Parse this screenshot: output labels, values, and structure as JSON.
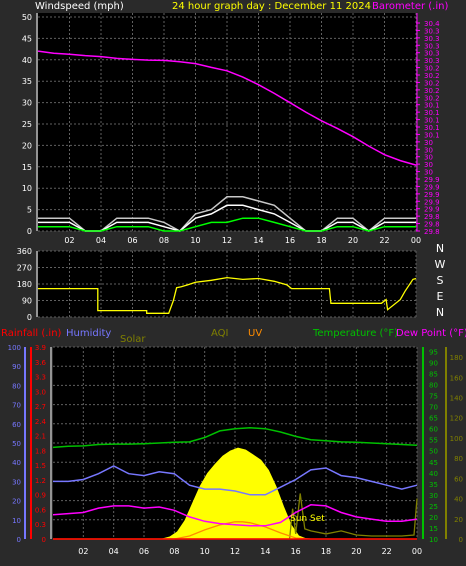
{
  "colors": {
    "background": "#2a2a2a",
    "plot_background": "#000000",
    "grid": "#606060",
    "white_text": "#ffffff",
    "wind": "#ffffff",
    "gust": "#c8c8c8",
    "wind_avg": "#00ff00",
    "barometer": "#ff00ff",
    "direction": "#ffff00",
    "rain": "#ff0000",
    "humidity": "#7777ff",
    "solar": "#ffff00",
    "aqi": "#808000",
    "uv": "#ff8c00",
    "temperature": "#00c000",
    "dewpoint": "#ff00ff",
    "title": "#ffff00"
  },
  "header": {
    "left_label": "Windspeed (mph)",
    "title": "24 hour graph day : December 11 2024",
    "right_label": "Barometer (.in)"
  },
  "legend": {
    "rain": "Rainfall (.in)",
    "humidity": "Humidity",
    "solar": "Solar",
    "aqi": "AQI",
    "uv": "UV",
    "temperature": "Temperature (°F)",
    "dewpoint": "Dew Point (°F)"
  },
  "annotations": {
    "sunset": "Sun Set"
  },
  "chart_data": [
    {
      "type": "line",
      "name": "wind-barometer",
      "x_ticks": [
        "02",
        "04",
        "06",
        "08",
        "10",
        "12",
        "14",
        "16",
        "18",
        "20",
        "22",
        "00"
      ],
      "y_left_ticks": [
        "0",
        "5",
        "10",
        "15",
        "20",
        "25",
        "30",
        "35",
        "40",
        "45",
        "50"
      ],
      "y_left_range": [
        0,
        50
      ],
      "y_right_ticks": [
        "29.8",
        "29.9",
        "30",
        "30.1",
        "30.2",
        "30.3",
        "30.4"
      ],
      "y_right_minor_ticks": [
        "29.8",
        "29.8",
        "29.8",
        "29.9",
        "29.9",
        "29.9",
        "29.9",
        "29.9",
        "30",
        "30",
        "30",
        "30",
        "30",
        "30.1",
        "30.1",
        "30.1",
        "30.1",
        "30.1",
        "30.2",
        "30.2",
        "30.2",
        "30.2",
        "30.2",
        "30.3",
        "30.3",
        "30.3",
        "30.3",
        "30.3",
        "30.4"
      ],
      "y_right_range": [
        29.8,
        30.4
      ],
      "x_range_hours": [
        0,
        24
      ],
      "series": [
        {
          "key": "barometer",
          "x": [
            0,
            1,
            2,
            3,
            4,
            5,
            6,
            7,
            8,
            9,
            10,
            11,
            12,
            13,
            14,
            15,
            16,
            17,
            18,
            19,
            20,
            21,
            22,
            23,
            24
          ],
          "values": [
            30.319,
            30.313,
            30.31,
            30.306,
            30.303,
            30.298,
            30.295,
            30.293,
            30.292,
            30.288,
            30.283,
            30.272,
            30.262,
            30.244,
            30.222,
            30.197,
            30.17,
            30.143,
            30.118,
            30.096,
            30.072,
            30.045,
            30.02,
            30.003,
            29.99
          ]
        },
        {
          "key": "gust",
          "x": [
            0,
            1,
            2,
            3,
            4,
            5,
            6,
            7,
            8,
            9,
            10,
            11,
            12,
            13,
            14,
            15,
            16,
            17,
            18,
            19,
            20,
            21,
            22,
            23,
            24
          ],
          "values": [
            3,
            3,
            3,
            0,
            0,
            3,
            3,
            3,
            2,
            0,
            4,
            5,
            8,
            8,
            7,
            6,
            3,
            0,
            0,
            3,
            3,
            0,
            3,
            3,
            3
          ]
        },
        {
          "key": "wind",
          "x": [
            0,
            1,
            2,
            3,
            4,
            5,
            6,
            7,
            8,
            9,
            10,
            11,
            12,
            13,
            14,
            15,
            16,
            17,
            18,
            19,
            20,
            21,
            22,
            23,
            24
          ],
          "values": [
            2,
            2,
            2,
            0,
            0,
            2,
            2,
            2,
            1,
            0,
            3,
            4,
            6,
            6,
            5,
            4,
            2,
            0,
            0,
            2,
            2,
            0,
            2,
            2,
            2
          ]
        },
        {
          "key": "wind_avg",
          "x": [
            0,
            1,
            2,
            3,
            4,
            5,
            6,
            7,
            8,
            9,
            10,
            11,
            12,
            13,
            14,
            15,
            16,
            17,
            18,
            19,
            20,
            21,
            22,
            23,
            24
          ],
          "values": [
            1,
            1,
            1,
            0,
            0,
            1,
            1,
            1,
            0,
            0,
            1,
            2,
            2,
            3,
            3,
            2,
            1,
            0,
            0,
            1,
            1,
            0,
            1,
            1,
            1
          ]
        }
      ]
    },
    {
      "type": "line",
      "name": "wind-direction",
      "y_left_ticks": [
        "0",
        "90",
        "180",
        "270",
        "360"
      ],
      "y_left_range": [
        0,
        360
      ],
      "compass": [
        "N",
        "W",
        "S",
        "E",
        "N"
      ],
      "x_range_hours": [
        0,
        24
      ],
      "series": [
        {
          "key": "direction",
          "x": [
            0,
            3.8,
            3.8,
            6.9,
            6.9,
            7.5,
            8.0,
            8.3,
            8.6,
            8.8,
            9.1,
            9.5,
            10,
            11,
            12,
            13,
            14,
            15,
            15.8,
            16.1,
            18.5,
            18.6,
            21.8,
            22.1,
            22.2,
            23,
            23.3,
            23.8,
            24
          ],
          "values": [
            155,
            155,
            35,
            35,
            20,
            20,
            20,
            20,
            90,
            160,
            165,
            175,
            190,
            200,
            215,
            205,
            210,
            195,
            175,
            155,
            155,
            75,
            75,
            95,
            40,
            95,
            140,
            205,
            210
          ]
        }
      ]
    },
    {
      "type": "area",
      "name": "temperature-humidity-rain-solar",
      "x_range_hours": [
        0,
        24
      ],
      "axes": {
        "humidity": {
          "ticks": [
            "0",
            "10",
            "20",
            "30",
            "40",
            "50",
            "60",
            "70",
            "80",
            "90",
            "100"
          ],
          "range": [
            0,
            100
          ]
        },
        "rain": {
          "ticks": [
            "0",
            "0.3",
            "0.6",
            "0.9",
            "1.2",
            "1.5",
            "1.8",
            "2.1",
            "2.4",
            "2.7",
            "3.0",
            "3.3",
            "3.6",
            "3.9"
          ],
          "range": [
            0,
            3.9
          ]
        },
        "temperature": {
          "ticks": [
            "10",
            "15",
            "20",
            "25",
            "30",
            "35",
            "40",
            "45",
            "50",
            "55",
            "60",
            "65",
            "70",
            "75",
            "80",
            "85",
            "90",
            "95"
          ],
          "range": [
            10,
            97
          ]
        },
        "solar": {
          "ticks": [
            "0",
            "20",
            "40",
            "60",
            "80",
            "100",
            "120",
            "140",
            "160",
            "180"
          ],
          "range": [
            0,
            190
          ]
        }
      },
      "series": [
        {
          "key": "temperature",
          "x": [
            0,
            1,
            2,
            3,
            4,
            5,
            6,
            7,
            8,
            9,
            10,
            11,
            12,
            13,
            14,
            15,
            16,
            17,
            18,
            19,
            20,
            21,
            22,
            23,
            24
          ],
          "values": [
            51.5,
            52,
            52.2,
            52.8,
            53,
            53,
            53.2,
            53.5,
            53.8,
            54,
            56,
            59,
            60,
            60.4,
            60,
            58.5,
            56.5,
            55,
            54.5,
            54,
            53.8,
            53.5,
            53.2,
            52.8,
            52.5
          ]
        },
        {
          "key": "humidity",
          "x": [
            0,
            1,
            2,
            3,
            4,
            5,
            6,
            7,
            8,
            9,
            10,
            11,
            12,
            13,
            14,
            15,
            16,
            17,
            18,
            19,
            20,
            21,
            22,
            23,
            24
          ],
          "values": [
            30,
            30,
            31,
            34,
            38,
            34,
            33,
            35,
            34,
            28,
            26,
            26,
            25,
            23,
            23,
            27,
            31,
            36,
            37,
            33,
            32,
            30,
            28,
            26,
            28
          ]
        },
        {
          "key": "dewpoint",
          "x": [
            0,
            1,
            2,
            3,
            4,
            5,
            6,
            7,
            8,
            9,
            10,
            11,
            12,
            13,
            14,
            15,
            16,
            17,
            18,
            19,
            20,
            21,
            22,
            23,
            24
          ],
          "values": [
            21,
            21.5,
            22,
            24,
            25,
            25,
            24,
            24.5,
            23,
            20,
            18,
            17,
            16.5,
            16,
            16,
            17.5,
            22,
            25.5,
            25,
            22,
            20,
            19,
            18,
            18,
            19
          ]
        },
        {
          "key": "solar",
          "x": [
            0,
            7.2,
            7.7,
            8.2,
            8.7,
            9.2,
            9.7,
            10.2,
            10.7,
            11.2,
            11.7,
            12.2,
            12.7,
            13.2,
            13.7,
            14.2,
            14.7,
            15.2,
            15.7,
            16.2,
            16.7,
            24
          ],
          "values": [
            0,
            0,
            2,
            7,
            18,
            35,
            52,
            65,
            74,
            82,
            87,
            90,
            88,
            83,
            78,
            68,
            52,
            32,
            14,
            3,
            0,
            0
          ]
        },
        {
          "key": "aqi",
          "x": [
            0,
            15.6,
            15.8,
            16.0,
            16.3,
            16.6,
            17,
            18,
            19,
            20,
            21,
            22,
            23,
            23.8,
            24
          ],
          "values": [
            0,
            0,
            30,
            5,
            45,
            10,
            8,
            5,
            8,
            4,
            3,
            3,
            3,
            4,
            40
          ]
        },
        {
          "key": "uv",
          "x": [
            0,
            8,
            9,
            10,
            11,
            12,
            12.5,
            13,
            14,
            15,
            16,
            17,
            24
          ],
          "values": [
            0,
            0,
            3,
            9,
            14,
            17,
            17,
            16,
            12,
            6,
            1,
            0,
            0
          ]
        },
        {
          "key": "rain",
          "x": [
            0,
            24
          ],
          "values": [
            0,
            0
          ]
        }
      ]
    }
  ]
}
